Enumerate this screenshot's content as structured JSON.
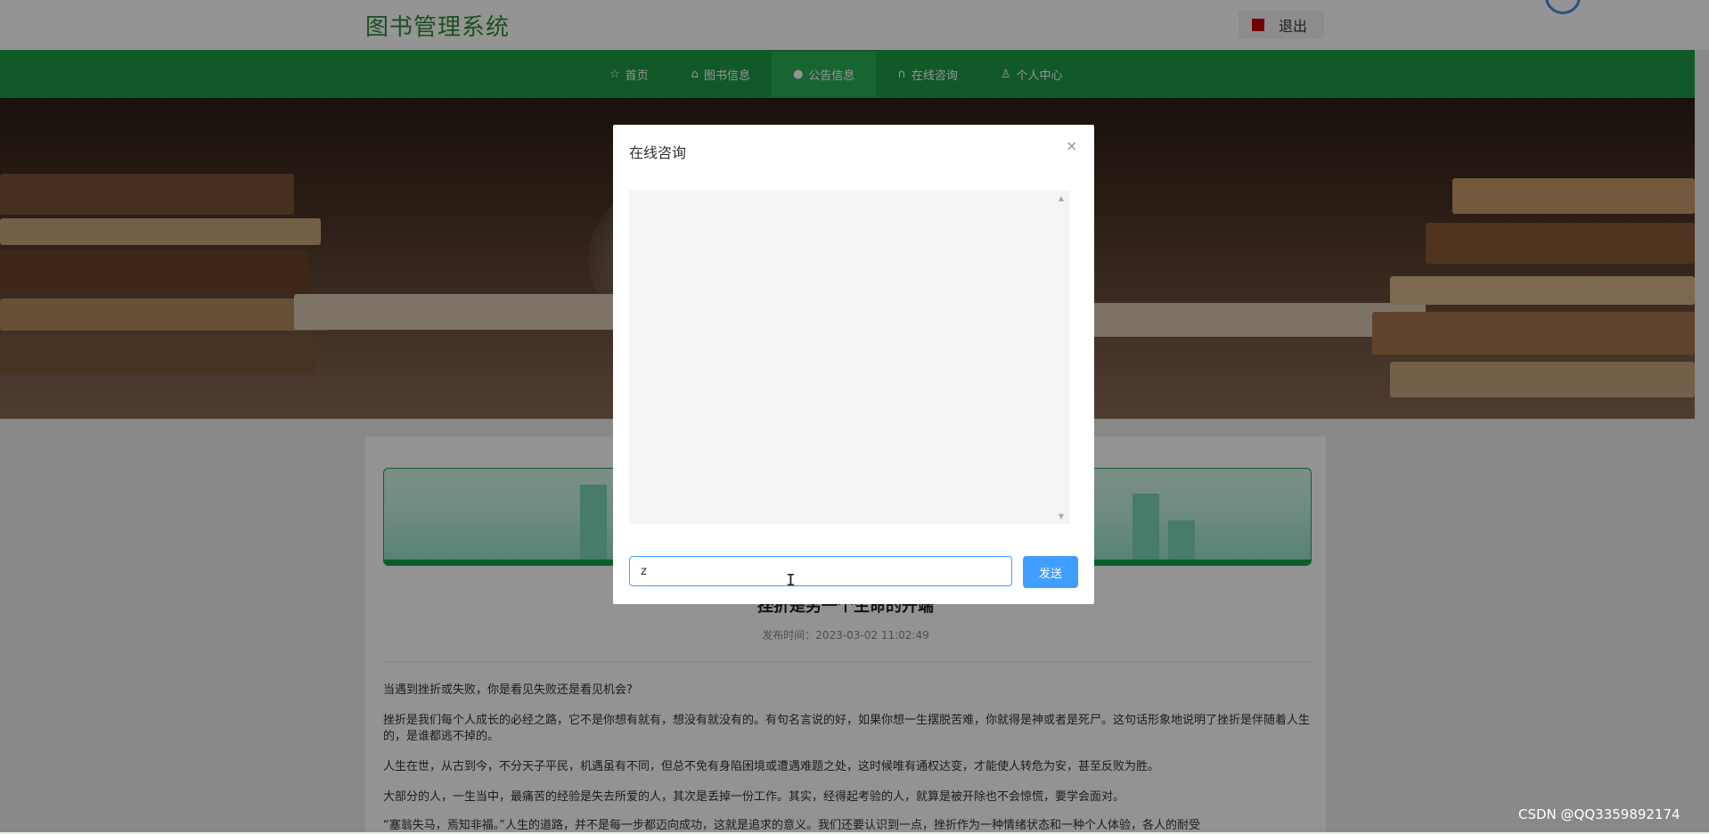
{
  "header": {
    "site_title": "图书管理系统",
    "logout_label": "退出"
  },
  "nav": {
    "items": [
      {
        "label": "首页",
        "icon": "star-icon"
      },
      {
        "label": "图书信息",
        "icon": "home-icon"
      },
      {
        "label": "公告信息",
        "icon": "circle-icon",
        "active": true
      },
      {
        "label": "在线咨询",
        "icon": "headset-icon"
      },
      {
        "label": "个人中心",
        "icon": "user-icon"
      }
    ]
  },
  "article": {
    "title": "挫折是另一个生命的开端",
    "publish_time": "发布时间：2023-03-02 11:02:49",
    "paragraphs": [
      "当遇到挫折或失败，你是看见失败还是看见机会?",
      "挫折是我们每个人成长的必经之路，它不是你想有就有，想没有就没有的。有句名言说的好，如果你想一生摆脱苦难，你就得是神或者是死尸。这句话形象地说明了挫折是伴随着人生的，是谁都逃不掉的。",
      "人生在世，从古到今，不分天子平民，机遇虽有不同，但总不免有身陷困境或遭遇难题之处，这时候唯有通权达变，才能使人转危为安，甚至反败为胜。",
      "大部分的人，一生当中，最痛苦的经验是失去所爱的人，其次是丢掉一份工作。其实，经得起考验的人，就算是被开除也不会惊慌，要学会面对。",
      "“塞翁失马，焉知非福。”人生的道路，并不是每一步都迈向成功，这就是追求的意义。我们还要认识到一点，挫折作为一种情绪状态和一种个人体验，各人的耐受"
    ]
  },
  "dialog": {
    "title": "在线咨询",
    "input_value": "z",
    "send_label": "发送"
  },
  "watermark": "CSDN @QQ3359892174",
  "colors": {
    "nav_green": "#1f9a47",
    "title_green": "#2e8b3a",
    "primary_blue": "#409eff"
  }
}
